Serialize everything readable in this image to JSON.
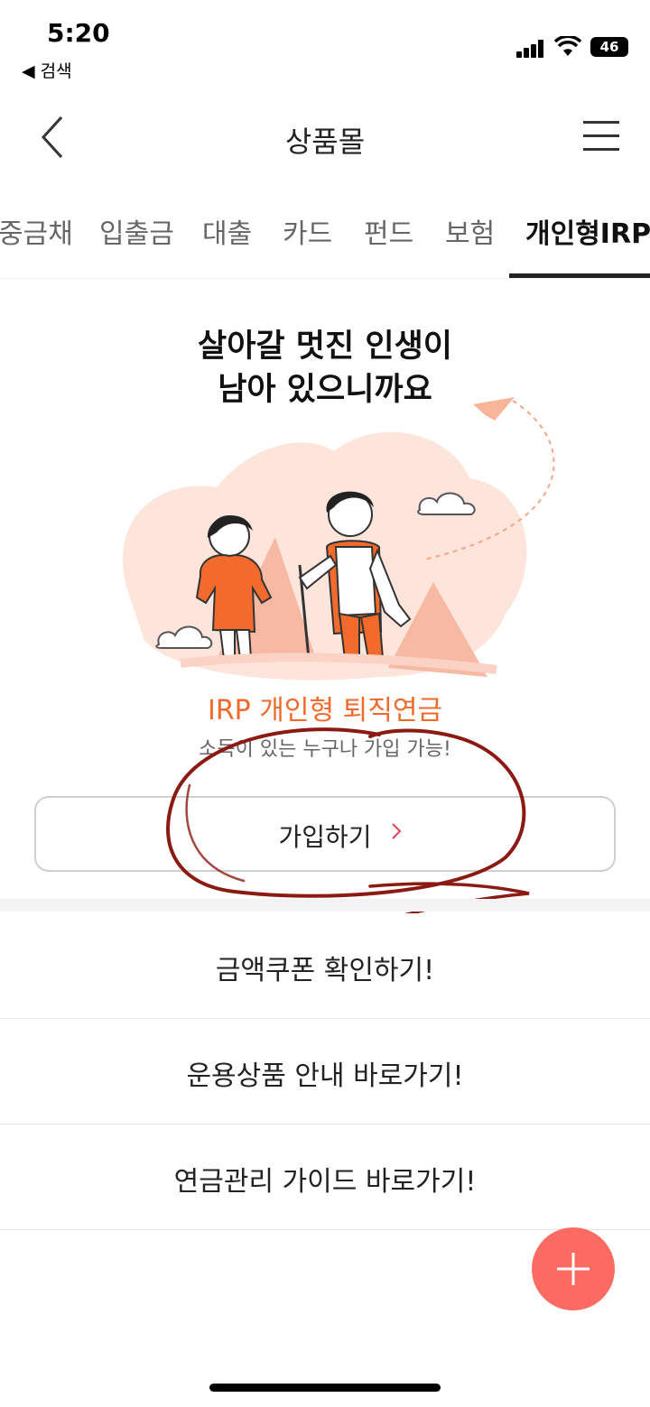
{
  "status_bar": {
    "time": "5:20",
    "back_app": "◀ 검색",
    "battery": "46"
  },
  "header": {
    "title": "상품몰"
  },
  "tabs": [
    {
      "label": "중금채"
    },
    {
      "label": "입출금"
    },
    {
      "label": "대출"
    },
    {
      "label": "카드"
    },
    {
      "label": "펀드"
    },
    {
      "label": "보험"
    },
    {
      "label": "개인형IRP",
      "active": true
    }
  ],
  "hero": {
    "line1": "살아갈 멋진 인생이",
    "line2": "남아 있으니까요"
  },
  "product": {
    "title": "IRP 개인형 퇴직연금",
    "subtitle": "소득이 있는 누구나 가입 가능!",
    "join_label": "가입하기"
  },
  "links": [
    {
      "label": "금액쿠폰 확인하기!"
    },
    {
      "label": "운용상품 안내 바로가기!"
    },
    {
      "label": "연금관리 가이드 바로가기!"
    }
  ],
  "colors": {
    "accent": "#f06a2b",
    "fab": "#fb6b61",
    "scribble": "#8b1a12",
    "chevron": "#e0405a"
  }
}
